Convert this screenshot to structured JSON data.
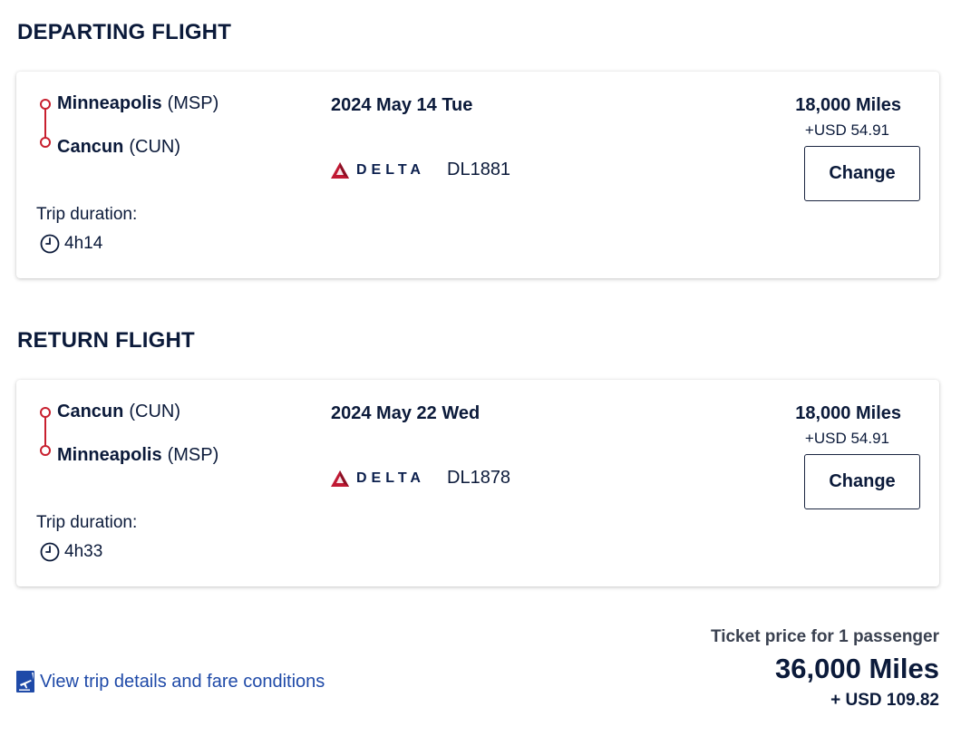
{
  "departing": {
    "section_title": "DEPARTING FLIGHT",
    "origin": {
      "city": "Minneapolis",
      "code": "(MSP)"
    },
    "destination": {
      "city": "Cancun",
      "code": "(CUN)"
    },
    "date": "2024 May 14 Tue",
    "airline": "DELTA",
    "flight_number": "DL1881",
    "miles": "18,000 Miles",
    "fee": "+USD 54.91",
    "change_label": "Change",
    "duration_label": "Trip duration:",
    "duration": "4h14"
  },
  "return": {
    "section_title": "RETURN FLIGHT",
    "origin": {
      "city": "Cancun",
      "code": "(CUN)"
    },
    "destination": {
      "city": "Minneapolis",
      "code": "(MSP)"
    },
    "date": "2024 May 22 Wed",
    "airline": "DELTA",
    "flight_number": "DL1878",
    "miles": "18,000 Miles",
    "fee": "+USD 54.91",
    "change_label": "Change",
    "duration_label": "Trip duration:",
    "duration": "4h33"
  },
  "footer": {
    "details_link": "View trip details and fare conditions",
    "ticket_label": "Ticket price for 1 passenger",
    "total_miles": "36,000 Miles",
    "total_usd": "+ USD 109.82"
  },
  "colors": {
    "route_red": "#c8202f",
    "link_blue": "#1f4aa8",
    "text_navy": "#0b1a3a",
    "delta_red": "#c01933"
  },
  "icons": {
    "route": "route-line-icon",
    "airline": "delta-logo-icon",
    "clock": "clock-icon",
    "details": "itinerary-icon"
  }
}
